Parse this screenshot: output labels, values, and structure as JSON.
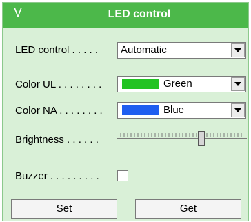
{
  "header": {
    "title": "LED control",
    "collapse_icon": "chevron-down-icon"
  },
  "fields": {
    "led_control": {
      "label": "LED control . . . . .",
      "value": "Automatic"
    },
    "color_ul": {
      "label": "Color UL . . . . . . . .",
      "value": "Green",
      "swatch": "#22c322"
    },
    "color_na": {
      "label": "Color NA . . . . . . . .",
      "value": "Blue",
      "swatch": "#1f5ef0"
    },
    "brightness": {
      "label": "Brightness . . . . . .",
      "level": 0.66
    },
    "buzzer": {
      "label": "Buzzer . . . . . . . . .",
      "checked": false
    }
  },
  "buttons": {
    "set": "Set",
    "get": "Get"
  }
}
